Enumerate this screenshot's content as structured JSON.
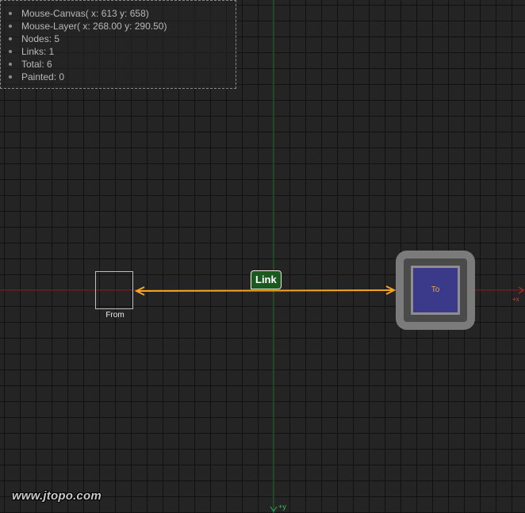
{
  "info_panel": {
    "items": [
      "Mouse-Canvas( x: 613 y: 658)",
      "Mouse-Layer( x: 268.00 y: 290.50)",
      "Nodes: 5",
      "Links: 1",
      "Total: 6",
      "Painted: 0"
    ]
  },
  "nodes": {
    "from_label": "From",
    "to_label": "To"
  },
  "link": {
    "label": "Link",
    "color": "#f5a623"
  },
  "axes": {
    "x_label": "+x",
    "y_label": "+y",
    "x_color": "#c0392b",
    "y_color": "#27ae60"
  },
  "watermark": "www.jtopo.com",
  "colors": {
    "background": "#242424",
    "link_label_bg": "#1a5a1f",
    "node_to_fill": "#3b3a8a"
  }
}
